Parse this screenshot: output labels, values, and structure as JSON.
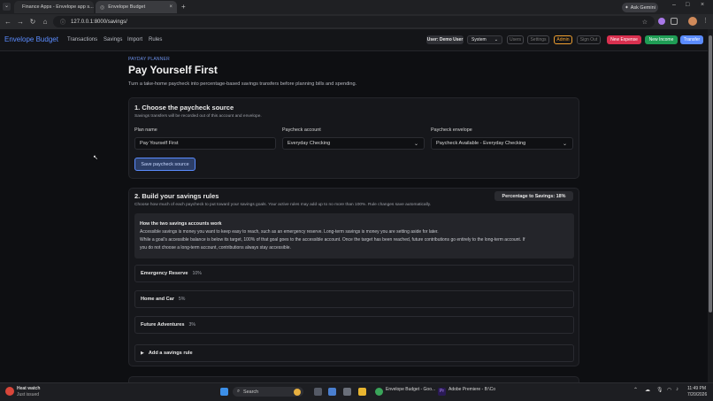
{
  "browser": {
    "tabs": [
      {
        "title": "Finance Apps - Envelope app s..."
      },
      {
        "title": "Envelope Budget"
      }
    ],
    "url": "127.0.0.1:8000/savings/",
    "ask_gemini": "Ask Gemini"
  },
  "app": {
    "brand": "Envelope Budget",
    "nav": [
      "Transactions",
      "Savings",
      "Import",
      "Rules"
    ],
    "user_label": "User: Demo User",
    "theme_select": "System",
    "header_buttons": {
      "users": "Users",
      "settings": "Settings",
      "admin": "Admin",
      "signout": "Sign Out",
      "new_expense": "New Expense",
      "new_income": "New Income",
      "transfer": "Transfer"
    },
    "colors": {
      "accent": "#5b8cff",
      "expense": "#d9304f",
      "income": "#1f9d55",
      "admin": "#f0a030"
    }
  },
  "page": {
    "eyebrow": "PAYDAY PLANNER",
    "title": "Pay Yourself First",
    "lede": "Turn a take-home paycheck into percentage-based savings transfers before planning bills and spending."
  },
  "section1": {
    "title": "1. Choose the paycheck source",
    "sub": "Savings transfers will be recorded out of this account and envelope.",
    "plan_name_label": "Plan name",
    "plan_name_value": "Pay Yourself First",
    "account_label": "Paycheck account",
    "account_value": "Everyday Checking",
    "envelope_label": "Paycheck envelope",
    "envelope_value": "Paycheck Available - Everyday Checking",
    "save_button": "Save paycheck source"
  },
  "section2": {
    "title": "2. Build your savings rules",
    "sub": "Choose how much of each paycheck to put toward your savings goals. Your active rules may add up to no more than 100%. Rule changes save automatically.",
    "badge": "Percentage to Savings: 18%",
    "info_title": "How the two savings accounts work",
    "info_line1": "Accessible savings is money you want to keep easy to reach, such as an emergency reserve. Long-term savings is money you are setting aside for later.",
    "info_line2": "While a goal's accessible balance is below its target, 100% of that goal goes to the accessible account. Once the target has been reached, future contributions go entirely to the long-term account. If",
    "info_line3": "you do not choose a long-term account, contributions always stay accessible.",
    "rules": [
      {
        "name": "Emergency Reserve",
        "percent": "10%"
      },
      {
        "name": "Home and Car",
        "percent": "5%"
      },
      {
        "name": "Future Adventures",
        "percent": "3%"
      }
    ],
    "add_rule": "Add a savings rule"
  },
  "taskbar": {
    "weather_title": "Heat watch",
    "weather_sub": "Just issued",
    "search": "Search",
    "apps": [
      "Envelope Budget - Goo...",
      "Adobe Premiere - B:\\Co"
    ],
    "time": "11:49 PM",
    "date": "7/20/2026"
  }
}
